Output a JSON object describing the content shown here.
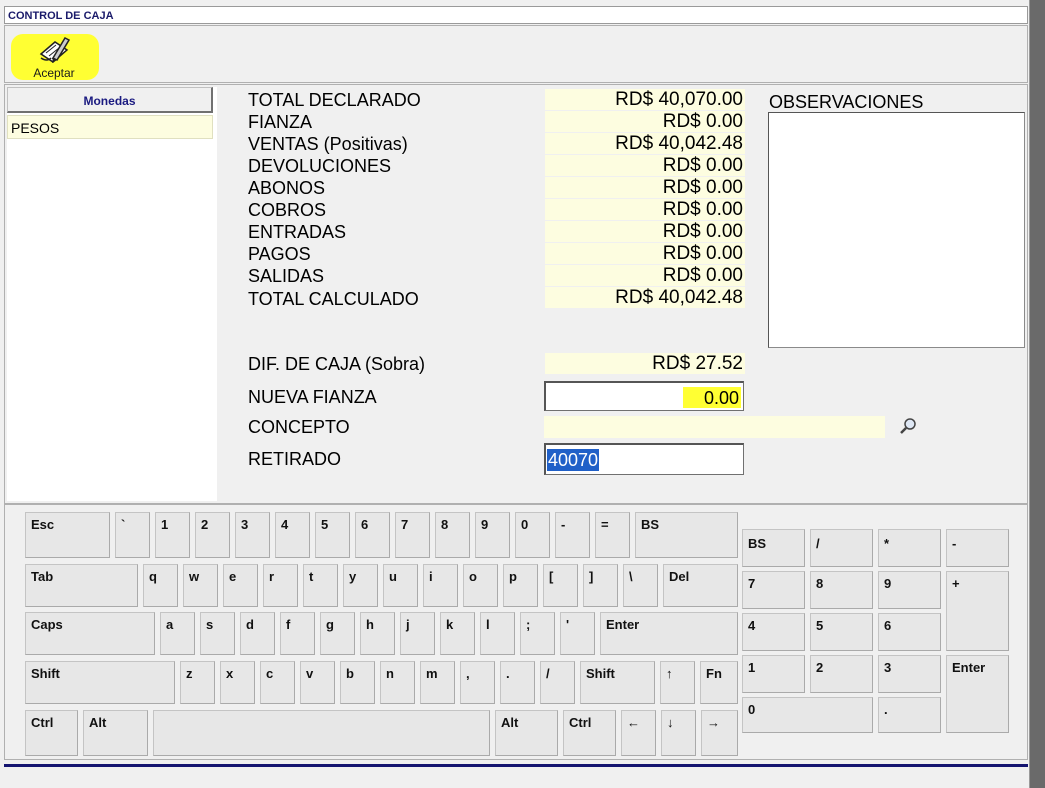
{
  "window": {
    "title": "CONTROL DE CAJA"
  },
  "toolbar": {
    "accept_label": "Aceptar"
  },
  "currency": {
    "header": "Monedas",
    "selected": "PESOS"
  },
  "summary": [
    {
      "label": "TOTAL DECLARADO",
      "value": "RD$ 40,070.00"
    },
    {
      "label": "FIANZA",
      "value": "RD$ 0.00"
    },
    {
      "label": "VENTAS (Positivas)",
      "value": "RD$ 40,042.48"
    },
    {
      "label": "DEVOLUCIONES",
      "value": "RD$ 0.00"
    },
    {
      "label": "ABONOS",
      "value": "RD$ 0.00"
    },
    {
      "label": "COBROS",
      "value": "RD$ 0.00"
    },
    {
      "label": "ENTRADAS",
      "value": "RD$ 0.00"
    },
    {
      "label": "PAGOS",
      "value": "RD$ 0.00"
    },
    {
      "label": "SALIDAS",
      "value": "RD$ 0.00"
    },
    {
      "label": "TOTAL CALCULADO",
      "value": "RD$ 40,042.48"
    }
  ],
  "observations": {
    "label": "OBSERVACIONES",
    "value": ""
  },
  "difference": {
    "label": "DIF. DE CAJA (Sobra)",
    "value": "RD$ 27.52"
  },
  "new_deposit": {
    "label": "NUEVA FIANZA",
    "value": "0.00"
  },
  "concept": {
    "label": "CONCEPTO",
    "value": ""
  },
  "withdrawn": {
    "label": "RETIRADO",
    "value": "40070"
  },
  "keyboard": {
    "row1": [
      "Esc",
      "`",
      "1",
      "2",
      "3",
      "4",
      "5",
      "6",
      "7",
      "8",
      "9",
      "0",
      "-",
      "=",
      "BS"
    ],
    "row2": [
      "Tab",
      "q",
      "w",
      "e",
      "r",
      "t",
      "y",
      "u",
      "i",
      "o",
      "p",
      "[",
      "]",
      "\\",
      "Del"
    ],
    "row3": [
      "Caps",
      "a",
      "s",
      "d",
      "f",
      "g",
      "h",
      "j",
      "k",
      "l",
      ";",
      "'",
      "Enter"
    ],
    "row4": [
      "Shift",
      "z",
      "x",
      "c",
      "v",
      "b",
      "n",
      "m",
      ",",
      ".",
      "/",
      "Shift",
      "↑",
      "Fn"
    ],
    "row5": [
      "Ctrl",
      "Alt",
      "",
      "Alt",
      "Ctrl",
      "←",
      "↓",
      "→"
    ],
    "numpad": [
      "BS",
      "/",
      "*",
      "-",
      "7",
      "8",
      "9",
      "+",
      "4",
      "5",
      "6",
      "1",
      "2",
      "3",
      "Enter",
      "0",
      "."
    ]
  }
}
